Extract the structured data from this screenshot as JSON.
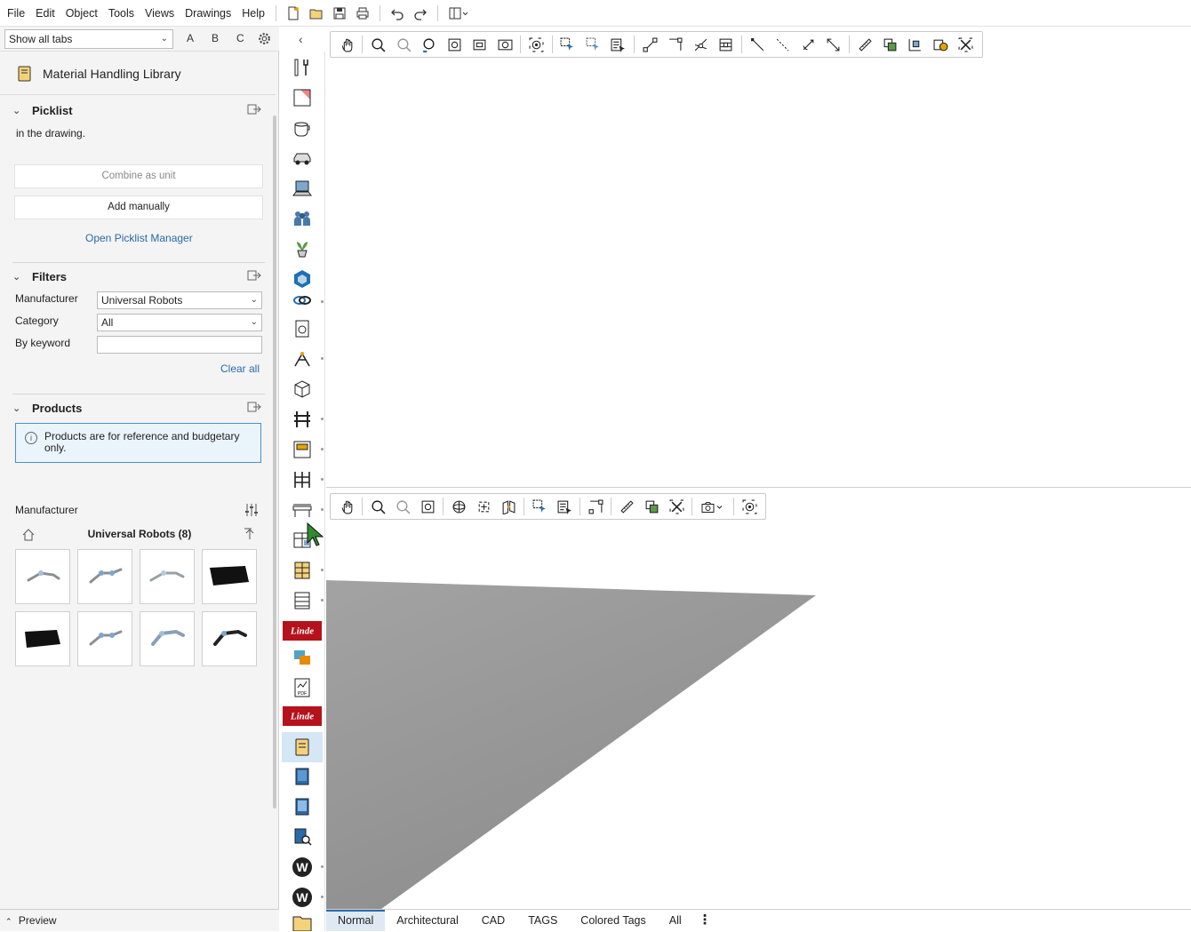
{
  "menu": [
    "File",
    "Edit",
    "Object",
    "Tools",
    "Views",
    "Drawings",
    "Help"
  ],
  "left_panel": {
    "tab_select": "Show all tabs",
    "letters": [
      "A",
      "B",
      "C"
    ],
    "library_title": "Material Handling Library",
    "picklist": {
      "title": "Picklist",
      "note": "in the drawing.",
      "combine_btn": "Combine as unit",
      "add_btn": "Add manually",
      "manager_link": "Open Picklist Manager"
    },
    "filters": {
      "title": "Filters",
      "manufacturer_label": "Manufacturer",
      "manufacturer_value": "Universal Robots",
      "category_label": "Category",
      "category_value": "All",
      "keyword_label": "By keyword",
      "keyword_value": "",
      "clear_link": "Clear all"
    },
    "products": {
      "title": "Products",
      "info": "Products are for reference and budgetary only.",
      "manufacturer_label": "Manufacturer",
      "group_title": "Universal Robots (8)"
    },
    "preview": "Preview"
  },
  "bottom_tabs": [
    "Normal",
    "Architectural",
    "CAD",
    "TAGS",
    "Colored Tags",
    "All"
  ],
  "colors": {
    "accent": "#2a6aa8",
    "info_bg": "#eaf4fb",
    "linde_red": "#b5121b",
    "floor": "#9a9a9a"
  }
}
